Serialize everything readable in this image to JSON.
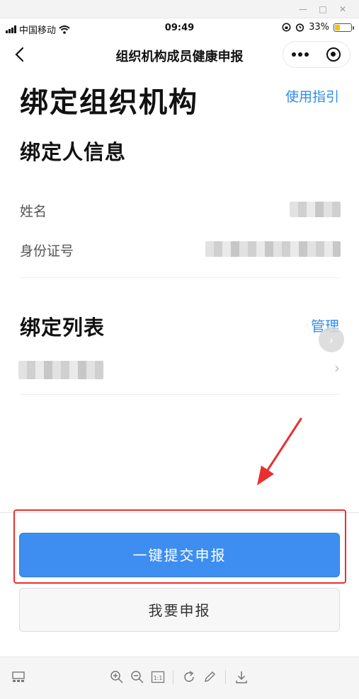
{
  "status": {
    "carrier": "中国移动",
    "time": "09:49",
    "battery": "33%",
    "battery_level": 0.33
  },
  "nav": {
    "title": "组织机构成员健康申报"
  },
  "page": {
    "title": "绑定组织机构",
    "guide_link": "使用指引"
  },
  "binder_info": {
    "heading": "绑定人信息",
    "name_label": "姓名",
    "id_label": "身份证号"
  },
  "bind_list": {
    "heading": "绑定列表",
    "manage_link": "管理"
  },
  "actions": {
    "submit_label": "一键提交申报",
    "report_label": "我要申报"
  },
  "colors": {
    "accent": "#3d8ef0",
    "link": "#2f8cf0",
    "annotation": "#e93030"
  }
}
